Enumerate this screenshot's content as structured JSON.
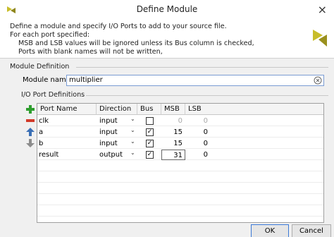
{
  "window": {
    "title": "Define Module",
    "close_label": "×"
  },
  "description": [
    "Define a module and specify I/O Ports to add to your source file.",
    "For each port specified:",
    "MSB and LSB values will be ignored unless its Bus column is checked,",
    "Ports with blank names will not be written,"
  ],
  "module_definition": {
    "section_label": "Module Definition",
    "name_label": "Module name:",
    "name_value": "multiplier"
  },
  "io_ports": {
    "section_label": "I/O Port Definitions",
    "columns": [
      "Port Name",
      "Direction",
      "Bus",
      "MSB",
      "LSB"
    ],
    "rows": [
      {
        "name": "clk",
        "direction": "input",
        "bus": false,
        "msb": "0",
        "lsb": "0"
      },
      {
        "name": "a",
        "direction": "input",
        "bus": true,
        "msb": "15",
        "lsb": "0"
      },
      {
        "name": "b",
        "direction": "input",
        "bus": true,
        "msb": "15",
        "lsb": "0"
      },
      {
        "name": "result",
        "direction": "output",
        "bus": true,
        "msb": "31",
        "lsb": "0"
      }
    ]
  },
  "buttons": {
    "ok": "OK",
    "cancel": "Cancel"
  },
  "colors": {
    "add": "#2e9e2e",
    "remove": "#d23a2a",
    "arrow": "#3a6fb5",
    "arrow_disabled": "#8c8c8c",
    "logo": "#c8bd2a"
  }
}
